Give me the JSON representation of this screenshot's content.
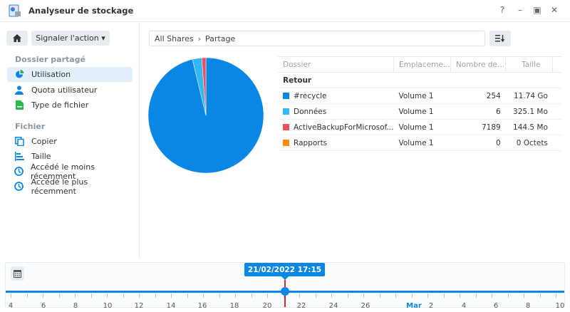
{
  "window": {
    "title": "Analyseur de stockage",
    "help": "?",
    "minimize": "–",
    "maximize": "▣",
    "close": "✕"
  },
  "toolbar": {
    "report_action": "Signaler l'action ▾"
  },
  "sidebar": {
    "sections": [
      {
        "title": "Dossier partagé",
        "items": [
          {
            "label": "Utilisation",
            "icon": "pie-chart-icon"
          },
          {
            "label": "Quota utilisateur",
            "icon": "user-icon"
          },
          {
            "label": "Type de fichier",
            "icon": "file-icon"
          }
        ]
      },
      {
        "title": "Fichier",
        "items": [
          {
            "label": "Copier",
            "icon": "copy-icon"
          },
          {
            "label": "Taille",
            "icon": "bar-size-icon"
          },
          {
            "label": "Accédé le moins récemment",
            "icon": "clock-icon"
          },
          {
            "label": "Accédé le plus récemment",
            "icon": "clock-icon"
          }
        ]
      }
    ]
  },
  "breadcrumb": {
    "root": "All Shares",
    "separator": "›",
    "current": "Partage"
  },
  "table": {
    "headers": [
      "Dossier",
      "Emplaceme...",
      "Nombre de...",
      "Taille"
    ],
    "back_label": "Retour",
    "rows": [
      {
        "name": "#recycle",
        "location": "Volume 1",
        "count": "254",
        "size": "11.74 Go",
        "color": "#0a86e4"
      },
      {
        "name": "Données",
        "location": "Volume 1",
        "count": "6",
        "size": "325.1 Mo",
        "color": "#36b7f5"
      },
      {
        "name": "ActiveBackupForMicrosof...",
        "location": "Volume 1",
        "count": "7189",
        "size": "144.5 Mo",
        "color": "#f0505a"
      },
      {
        "name": "Rapports",
        "location": "Volume 1",
        "count": "0",
        "size": "0 Octets",
        "color": "#ff8c00"
      }
    ]
  },
  "chart_data": {
    "type": "pie",
    "labels": [
      "#recycle",
      "Données",
      "ActiveBackupForMicrosof...",
      "Rapports"
    ],
    "values_mb": [
      12021.76,
      325.1,
      144.5,
      0
    ],
    "colors": [
      "#0a86e4",
      "#36b7f5",
      "#f0505a",
      "#ff8c00"
    ]
  },
  "timeline": {
    "selected": "21/02/2022 17:15",
    "labels": [
      "4",
      "6",
      "8",
      "10",
      "12",
      "14",
      "16",
      "18",
      "20",
      "22",
      "24",
      "26",
      "Mar",
      "2",
      "4",
      "6",
      "8",
      "10"
    ]
  }
}
